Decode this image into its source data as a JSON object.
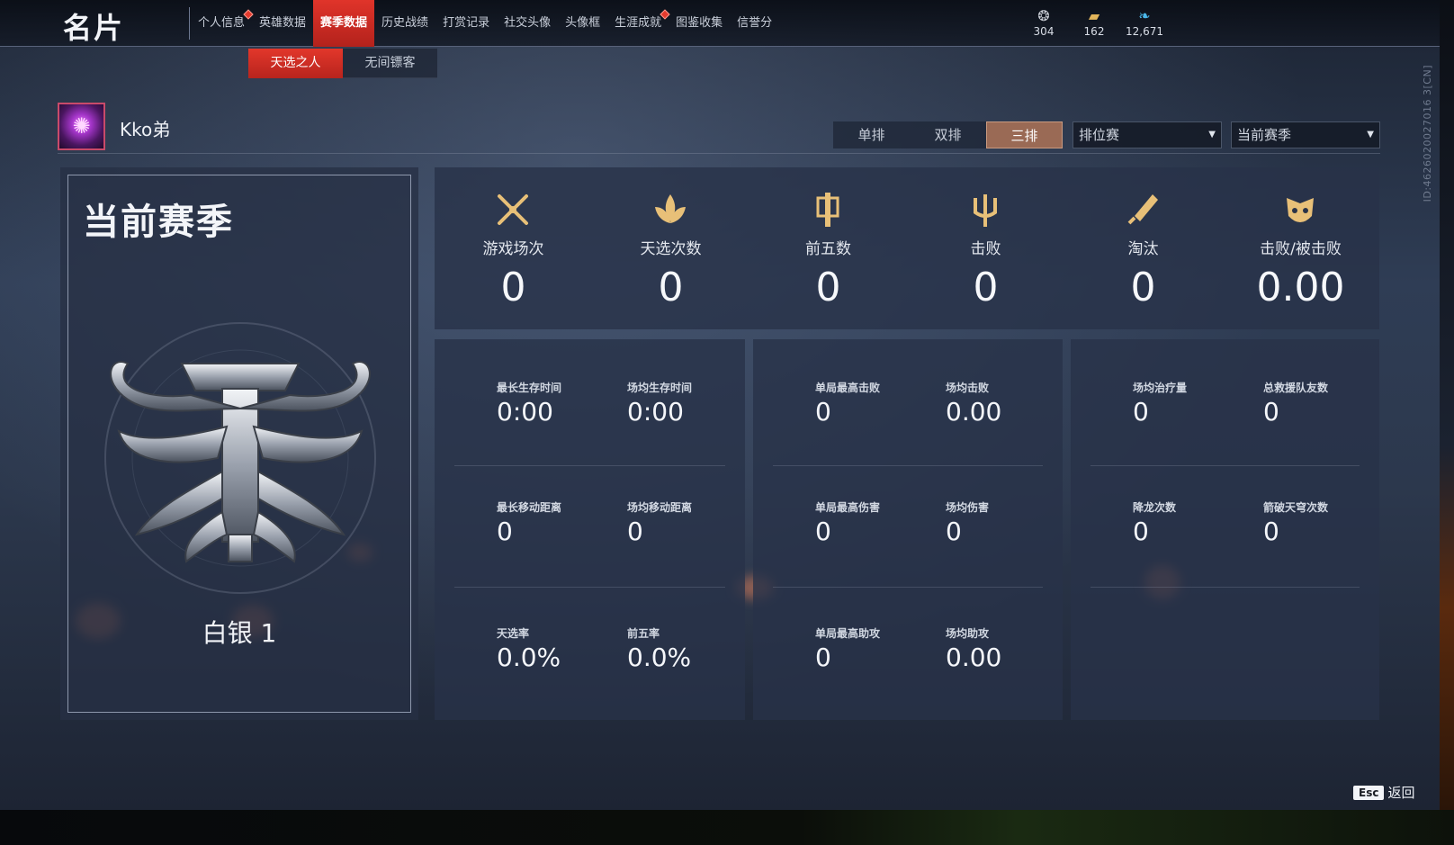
{
  "header": {
    "title": "名片",
    "tabs": [
      {
        "label": "个人信息",
        "badge": true
      },
      {
        "label": "英雄数据",
        "badge": false
      },
      {
        "label": "赛季数据",
        "badge": false,
        "active": true
      },
      {
        "label": "历史战绩",
        "badge": false
      },
      {
        "label": "打赏记录",
        "badge": false
      },
      {
        "label": "社交头像",
        "badge": false
      },
      {
        "label": "头像框",
        "badge": false
      },
      {
        "label": "生涯成就",
        "badge": true
      },
      {
        "label": "图鉴收集",
        "badge": false
      },
      {
        "label": "信誉分",
        "badge": false
      }
    ],
    "currencies": [
      {
        "icon": "coin-icon",
        "value": "304"
      },
      {
        "icon": "treasure-chest-icon",
        "value": "162"
      },
      {
        "icon": "feather-icon",
        "value": "12,671"
      }
    ]
  },
  "sub_tabs": [
    {
      "label": "天选之人",
      "active": true
    },
    {
      "label": "无间镖客",
      "active": false
    }
  ],
  "profile": {
    "name": "Kko弟",
    "avatar_icon": "purple-flame-avatar"
  },
  "filters": {
    "modes": [
      {
        "label": "单排",
        "active": false
      },
      {
        "label": "双排",
        "active": false
      },
      {
        "label": "三排",
        "active": true
      }
    ],
    "match_type": "排位赛",
    "season": "当前赛季"
  },
  "rank": {
    "title": "当前赛季",
    "tier": "白银 1",
    "emblem_icon": "silver-mask-emblem"
  },
  "summary_stats": [
    {
      "icon": "crossed-swords-icon",
      "label": "游戏场次",
      "value": "0"
    },
    {
      "icon": "lotus-crest-icon",
      "label": "天选次数",
      "value": "0"
    },
    {
      "icon": "banner-icon",
      "label": "前五数",
      "value": "0"
    },
    {
      "icon": "trident-icon",
      "label": "击败",
      "value": "0"
    },
    {
      "icon": "broken-blade-icon",
      "label": "淘汰",
      "value": "0"
    },
    {
      "icon": "demon-mask-icon",
      "label": "击败/被击败",
      "value": "0.00"
    }
  ],
  "detail_panels": [
    {
      "cells": [
        {
          "label": "最长生存时间",
          "value": "0:00"
        },
        {
          "label": "场均生存时间",
          "value": "0:00"
        },
        {
          "label": "最长移动距离",
          "value": "0"
        },
        {
          "label": "场均移动距离",
          "value": "0"
        },
        {
          "label": "天选率",
          "value": "0.0%"
        },
        {
          "label": "前五率",
          "value": "0.0%"
        }
      ]
    },
    {
      "cells": [
        {
          "label": "单局最高击败",
          "value": "0"
        },
        {
          "label": "场均击败",
          "value": "0.00"
        },
        {
          "label": "单局最高伤害",
          "value": "0"
        },
        {
          "label": "场均伤害",
          "value": "0"
        },
        {
          "label": "单局最高助攻",
          "value": "0"
        },
        {
          "label": "场均助攻",
          "value": "0.00"
        }
      ]
    },
    {
      "cells": [
        {
          "label": "场均治疗量",
          "value": "0"
        },
        {
          "label": "总救援队友数",
          "value": "0"
        },
        {
          "label": "降龙次数",
          "value": "0"
        },
        {
          "label": "箭破天穹次数",
          "value": "0"
        }
      ]
    }
  ],
  "vertical_id": "ID:4626020027016 3[CN]",
  "footer": {
    "key": "Esc",
    "label": "返回"
  },
  "colors": {
    "accent": "#e0342a",
    "mode_active": "#9a6a55",
    "gold": "#e8c078"
  }
}
